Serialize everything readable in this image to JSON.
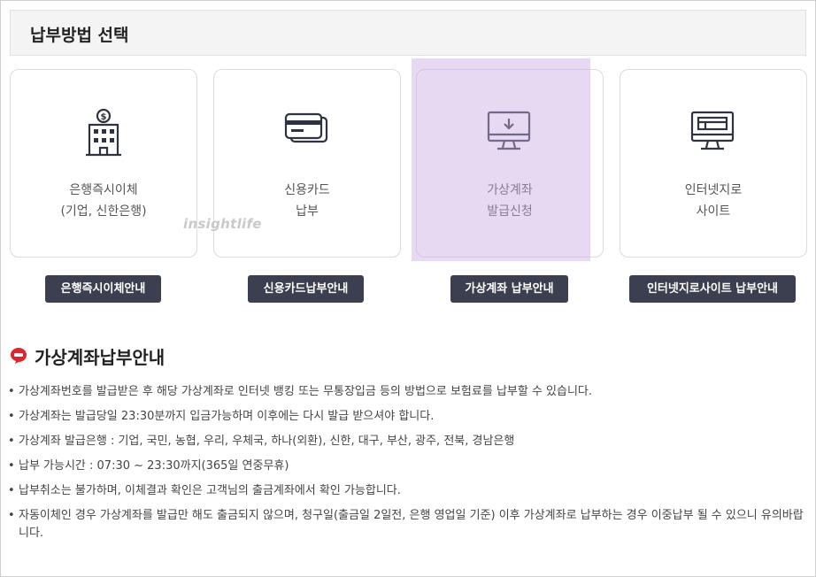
{
  "header": {
    "title": "납부방법 선택"
  },
  "cards": [
    {
      "line1": "은행즉시이체",
      "line2": "(기업, 신한은행)",
      "icon": "bank-building-icon"
    },
    {
      "line1": "신용카드",
      "line2": "납부",
      "icon": "credit-card-icon"
    },
    {
      "line1": "가상계좌",
      "line2": "발급신청",
      "icon": "monitor-download-icon"
    },
    {
      "line1": "인터넷지로",
      "line2": "사이트",
      "icon": "monitor-web-icon"
    }
  ],
  "guide_buttons": [
    "은행즉시이체안내",
    "신용카드납부안내",
    "가상계좌 납부안내",
    "인터넷지로사이트 납부안내"
  ],
  "watermark": "insightlife",
  "section": {
    "title": "가상계좌납부안내",
    "notes": [
      "가상계좌번호를 발급받은 후 해당 가상계좌로 인터넷 뱅킹 또는 무통장입금 등의 방법으로 보험료를 납부할 수 있습니다.",
      "가상계좌는 발급당일 23:30분까지 입금가능하며 이후에는 다시 발급 받으셔야 합니다.",
      "가상계좌 발급은행 : 기업, 국민, 농협, 우리, 우체국, 하나(외환), 신한, 대구, 부산, 광주, 전북, 경남은행",
      "납부 가능시간 : 07:30 ~ 23:30까지(365일 연중무휴)",
      "납부취소는 불가하며, 이체결과 확인은 고객님의 출금계좌에서 확인 가능합니다.",
      "자동이체인 경우 가상계좌를 발급만 해도 출금되지 않으며, 청구일(출금일 2일전, 은행 영업일 기준) 이후 가상계좌로 납부하는 경우 이중납부 될 수 있으니 유의바랍니다."
    ]
  },
  "colors": {
    "button_bg": "#3b3f4f",
    "highlight": "#d9c4ec",
    "section_icon": "#e0242b"
  }
}
